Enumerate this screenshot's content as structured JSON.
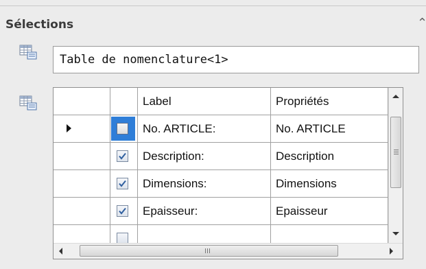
{
  "panel": {
    "title": "Sélections",
    "collapse_icon": "chevron-up-icon"
  },
  "selection": {
    "icon": "table-select-icon",
    "value": "Table de nomenclature<1>"
  },
  "grid": {
    "icon": "table-select-icon",
    "columns": [
      "",
      "",
      "Label",
      "Propriétés"
    ],
    "rows": [
      {
        "current": true,
        "checked": false,
        "label": "No. ARTICLE:",
        "property": "No. ARTICLE"
      },
      {
        "current": false,
        "checked": true,
        "label": "Description:",
        "property": "Description"
      },
      {
        "current": false,
        "checked": true,
        "label": "Dimensions:",
        "property": "Dimensions"
      },
      {
        "current": false,
        "checked": true,
        "label": "Epaisseur:",
        "property": "Epaisseur"
      },
      {
        "current": false,
        "checked": true,
        "label": "",
        "property": ""
      }
    ]
  },
  "colors": {
    "focus_blue": "#2f7ed8",
    "check_blue": "#2f5f9f"
  }
}
